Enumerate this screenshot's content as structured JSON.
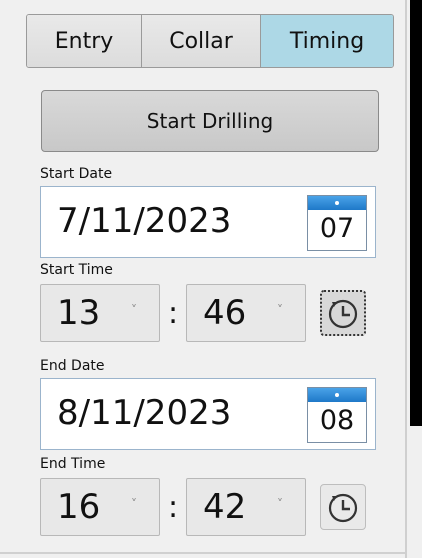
{
  "tabs": [
    {
      "label": "Entry",
      "active": false
    },
    {
      "label": "Collar",
      "active": false
    },
    {
      "label": "Timing",
      "active": true
    }
  ],
  "start_button": {
    "label": "Start Drilling"
  },
  "start_date": {
    "label": "Start Date",
    "value": "7/11/2023",
    "calendar_day": "07"
  },
  "start_time": {
    "label": "Start Time",
    "hour": "13",
    "minute": "46",
    "separator": ":"
  },
  "end_date": {
    "label": "End Date",
    "value": "8/11/2023",
    "calendar_day": "08"
  },
  "end_time": {
    "label": "End Time",
    "hour": "16",
    "minute": "42",
    "separator": ":"
  },
  "icons": {
    "dropdown": "chevron-down-icon",
    "calendar": "calendar-icon",
    "clock": "clock-icon"
  },
  "colors": {
    "active_tab": "#add8e6",
    "calendar_header": "#1e78c8"
  }
}
